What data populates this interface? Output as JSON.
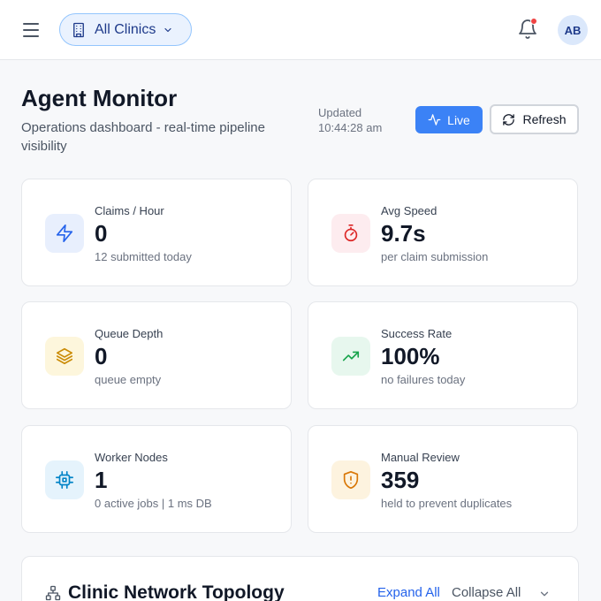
{
  "header": {
    "clinic_selector": "All Clinics",
    "avatar_initials": "AB"
  },
  "page": {
    "title": "Agent Monitor",
    "subtitle": "Operations dashboard - real-time pipeline visibility",
    "updated_label": "Updated",
    "updated_time": "10:44:28 am",
    "live_label": "Live",
    "refresh_label": "Refresh"
  },
  "stats": [
    {
      "label": "Claims / Hour",
      "value": "0",
      "sub": "12 submitted today",
      "icon": "lightning-icon",
      "tint": "#e8effd",
      "color": "#2563eb"
    },
    {
      "label": "Avg Speed",
      "value": "9.7s",
      "sub": "per claim submission",
      "icon": "stopwatch-icon",
      "tint": "#fdecef",
      "color": "#dc2626"
    },
    {
      "label": "Queue Depth",
      "value": "0",
      "sub": "queue empty",
      "icon": "layers-icon",
      "tint": "#fdf6dc",
      "color": "#ca8a04"
    },
    {
      "label": "Success Rate",
      "value": "100%",
      "sub": "no failures today",
      "icon": "trending-up-icon",
      "tint": "#e7f7ee",
      "color": "#16a34a"
    },
    {
      "label": "Worker Nodes",
      "value": "1",
      "sub": "0 active jobs | 1 ms DB",
      "icon": "cpu-icon",
      "tint": "#e5f3fc",
      "color": "#0284c7"
    },
    {
      "label": "Manual Review",
      "value": "359",
      "sub": "held to prevent duplicates",
      "icon": "shield-alert-icon",
      "tint": "#fdf3df",
      "color": "#d97706"
    }
  ],
  "topology": {
    "title": "Clinic Network Topology",
    "expand_all": "Expand All",
    "collapse_all": "Collapse All"
  }
}
